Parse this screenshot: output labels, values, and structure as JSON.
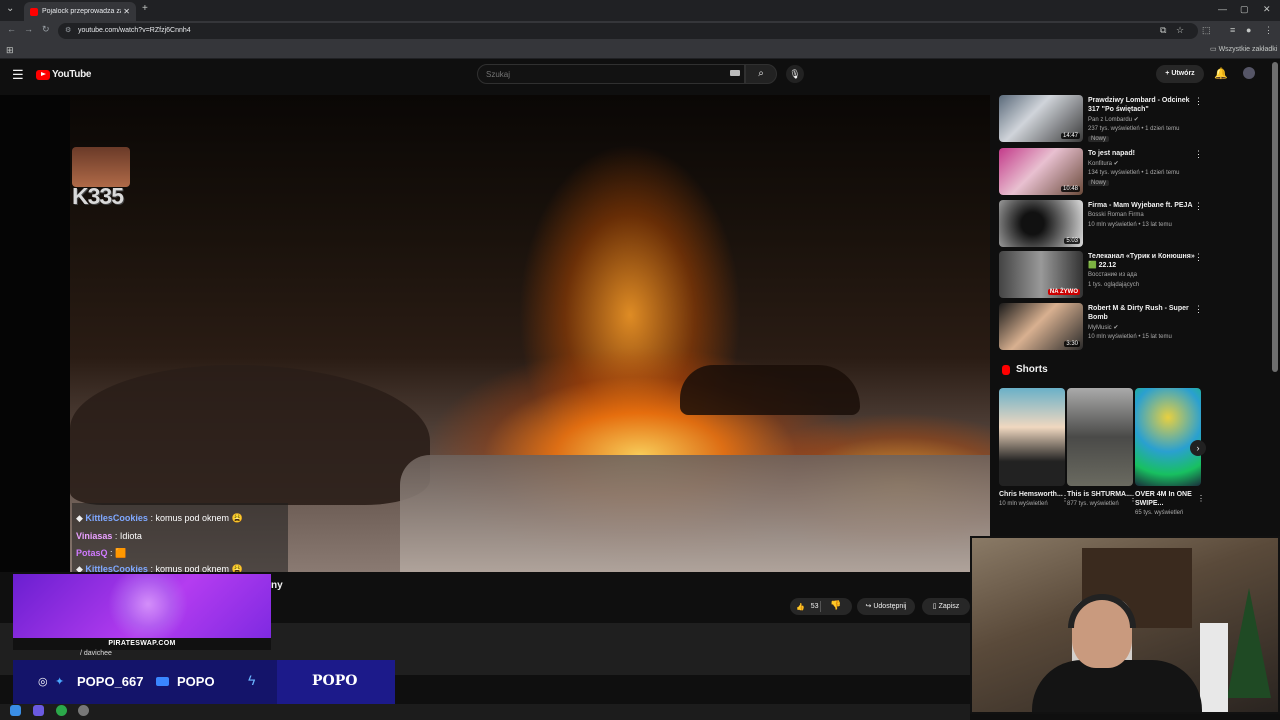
{
  "browser": {
    "tab_title": "Pojalock przeprowadza zamach",
    "url": "youtube.com/watch?v=RZfzj6Cnnh4",
    "bookmarks_label": "Wszystkie zakładki"
  },
  "masthead": {
    "logo_text": "YouTube",
    "search_placeholder": "Szukaj",
    "create_label": "Utwórz"
  },
  "video": {
    "overlay_text": "K335",
    "title_tail": "ny",
    "likes": "53",
    "share_label": "Udostępnij",
    "save_label": "Zapisz"
  },
  "chat": [
    {
      "user": "KittlesCookies",
      "message": "komus pod oknem 😩",
      "color": "#7fa8ff"
    },
    {
      "user": "Viniasas",
      "message": "Idiota",
      "color": "#e8a0ff"
    },
    {
      "user": "PotasQ",
      "message": "🟧",
      "color": "#d07aff"
    },
    {
      "user": "KittlesCookies",
      "message": "komus pod oknem 😩",
      "color": "#7fa8ff"
    }
  ],
  "stream_overlay": {
    "sponsor_url": "PIRATESWAP.COM",
    "handle_small": "/ davichee",
    "social_handle": "POPO_667",
    "yt_channel": "POPO",
    "brand": "POPO"
  },
  "sidebar": {
    "recommendations": [
      {
        "title": "Prawdziwy Lombard - Odcinek 317 \"Po świętach\"",
        "channel": "Pan z Lombardu ✔",
        "meta": "237 tys. wyświetleń • 1 dzień temu",
        "badge": "Nowy",
        "duration": "14:47",
        "live": ""
      },
      {
        "title": "To jest napad!",
        "channel": "Konfitura ✔",
        "meta": "134 tys. wyświetleń • 1 dzień temu",
        "badge": "Nowy",
        "duration": "10:48",
        "live": ""
      },
      {
        "title": "Firma - Mam Wyjebane ft. PEJA",
        "channel": "Bosski Roman Firma",
        "meta": "10 mln wyświetleń • 13 lat temu",
        "badge": "",
        "duration": "5:03",
        "live": ""
      },
      {
        "title": "Телеканал «Турик и Конюшня» 🟩 22.12",
        "channel": "Восстание из ада",
        "meta": "1 tys. oglądających",
        "badge": "",
        "duration": "",
        "live": "NA ŻYWO"
      },
      {
        "title": "Robert M & Dirty Rush - Super Bomb",
        "channel": "MyMusic ✔",
        "meta": "10 mln wyświetleń • 15 lat temu",
        "badge": "",
        "duration": "3:30",
        "live": ""
      }
    ],
    "shorts_label": "Shorts",
    "shorts": [
      {
        "title": "Chris Hemsworth...",
        "views": "10 mln wyświetleń"
      },
      {
        "title": "This is SHTURMA...",
        "views": "877 tys. wyświetleń"
      },
      {
        "title": "OVER 4M In ONE SWIPE...",
        "views": "65 tys. wyświetleń"
      }
    ]
  }
}
